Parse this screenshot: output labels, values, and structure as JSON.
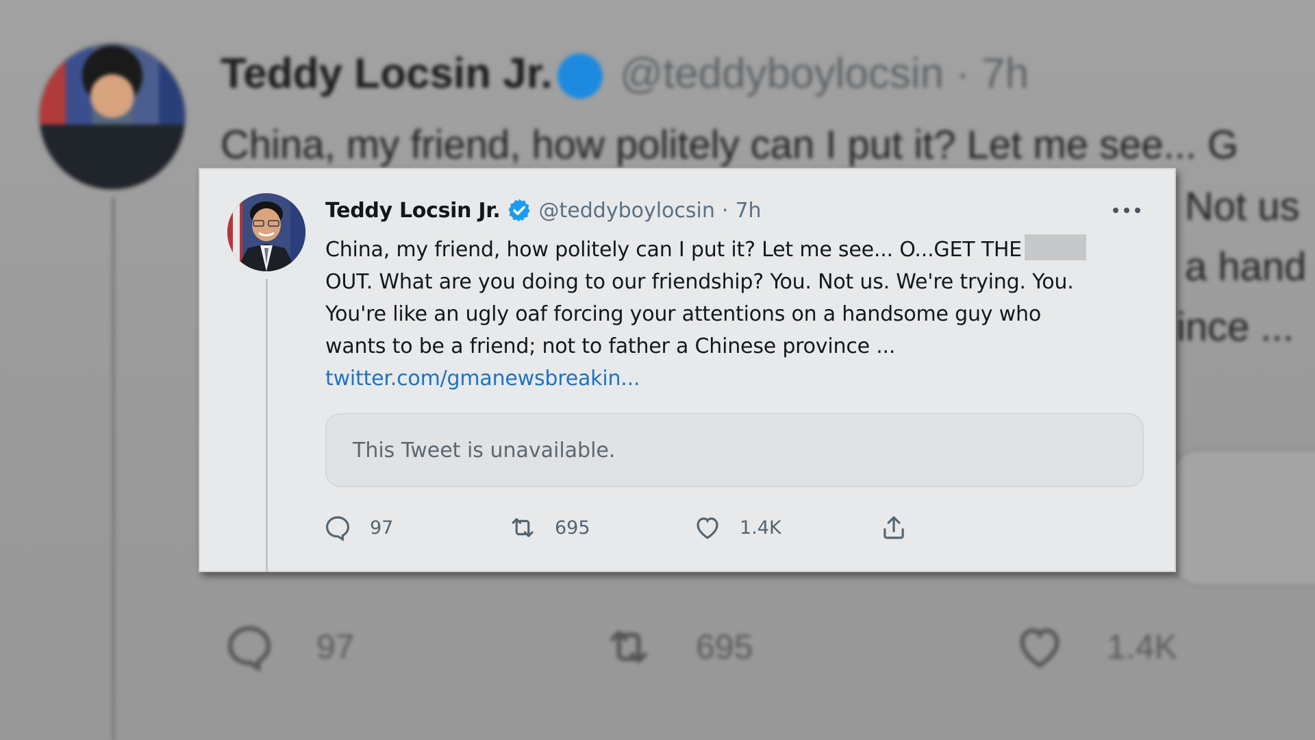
{
  "background_tweet": {
    "name": "Teddy Locsin Jr.",
    "handle_time": "@teddyboylocsin · 7h",
    "text_line_1": "China, my friend, how politely can I put it? Let me see... G",
    "fragment_1": "Not us",
    "fragment_2": "a hand",
    "fragment_3": "ince ...",
    "actions": {
      "reply_count": "97",
      "retweet_count": "695",
      "like_count": "1.4K"
    }
  },
  "tweet": {
    "author_name": "Teddy Locsin Jr.",
    "handle": "@teddyboylocsin",
    "separator": "·",
    "time": "7h",
    "text_lines": [
      "China, my friend, how politely can I put it? Let me see... O...GET THE",
      "OUT. What are you doing to our friendship? You. Not us. We're trying. You.",
      "You're like an ugly oaf forcing your attentions on a handsome guy who",
      "wants to be a friend; not to father a Chinese province ..."
    ],
    "link": "twitter.com/gmanewsbreakin...",
    "quoted_tweet_message": "This Tweet is unavailable.",
    "actions": {
      "reply_count": "97",
      "retweet_count": "695",
      "like_count": "1.4K"
    }
  },
  "icons": {
    "verified": "verified-badge-icon",
    "more": "more-options-icon",
    "reply": "reply-icon",
    "retweet": "retweet-icon",
    "like": "heart-icon",
    "share": "share-icon"
  },
  "colors": {
    "verified_blue": "#1d9bf0",
    "link_blue": "#1a74c4",
    "secondary_text": "#5b7083"
  }
}
